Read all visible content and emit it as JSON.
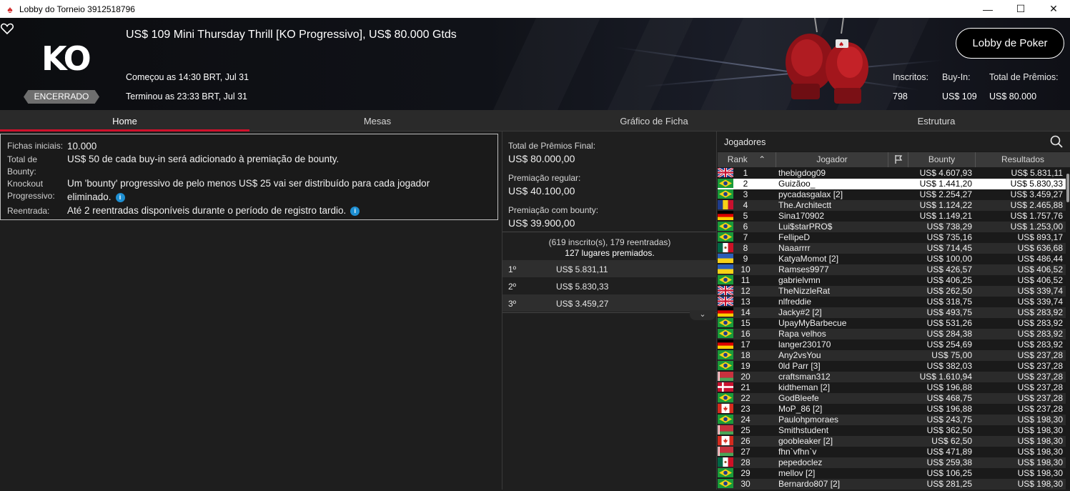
{
  "window": {
    "title": "Lobby do Torneio 3912518796",
    "minimize": "—",
    "maximize": "☐",
    "close": "✕"
  },
  "banner": {
    "ko_logo": "KO",
    "status": "ENCERRADO",
    "title": "US$ 109 Mini Thursday Thrill [KO Progressivo], US$ 80.000 Gtds",
    "started": "Começou as 14:30 BRT, Jul 31",
    "ended": "Terminou as 23:33 BRT, Jul 31",
    "lobby_button": "Lobby de Poker",
    "stats": {
      "registered_label": "Inscritos:",
      "registered_value": "798",
      "buyin_label": "Buy-In:",
      "buyin_value": "US$ 109",
      "prize_label": "Total de Prêmios:",
      "prize_value": "US$ 80.000"
    }
  },
  "tabs": [
    {
      "label": "Home",
      "active": true
    },
    {
      "label": "Mesas",
      "active": false
    },
    {
      "label": "Gráfico de Ficha",
      "active": false
    },
    {
      "label": "Estrutura",
      "active": false
    }
  ],
  "info": {
    "starting_chips_label": "Fichas iniciais:",
    "starting_chips_value": "10.000",
    "total_bounty_label": "Total de Bounty:",
    "total_bounty_value": "US$ 50 de cada buy-in será adicionado à premiação de bounty.",
    "knockout_label": "Knockout Progressivo:",
    "knockout_value": "Um 'bounty' progressivo de pelo menos US$ 25 vai ser distribuído para cada jogador eliminado.",
    "reentry_label": "Reentrada:",
    "reentry_value": "Até 2 reentradas disponíveis durante o período de registro tardio."
  },
  "prize": {
    "final_label": "Total de Prêmios Final:",
    "final_value": "US$ 80.000,00",
    "regular_label": "Premiação regular:",
    "regular_value": "US$ 40.100,00",
    "bounty_label": "Premiação com bounty:",
    "bounty_value": "US$ 39.900,00",
    "summary1": "(619 inscrito(s), 179 reentradas)",
    "summary2": "127 lugares premiados.",
    "places": [
      {
        "pos": "1º",
        "amount": "US$ 5.831,11"
      },
      {
        "pos": "2º",
        "amount": "US$ 5.830,33"
      },
      {
        "pos": "3º",
        "amount": "US$ 3.459,27"
      }
    ],
    "more": "⌄"
  },
  "players": {
    "title": "Jogadores",
    "columns": {
      "rank": "Rank",
      "rank_sort": "⌃",
      "player": "Jogador",
      "bounty": "Bounty",
      "results": "Resultados"
    },
    "rows": [
      {
        "rank": "1",
        "name": "thebigdog09",
        "flag": "uk",
        "bounty": "US$ 4.607,93",
        "result": "US$ 5.831,11"
      },
      {
        "rank": "2",
        "name": "Guizãoo_",
        "flag": "br",
        "bounty": "US$ 1.441,20",
        "result": "US$ 5.830,33"
      },
      {
        "rank": "3",
        "name": "pycadasgalax [2]",
        "flag": "br",
        "bounty": "US$ 2.254,27",
        "result": "US$ 3.459,27"
      },
      {
        "rank": "4",
        "name": "The.Architectt",
        "flag": "ro",
        "bounty": "US$ 1.124,22",
        "result": "US$ 2.465,88"
      },
      {
        "rank": "5",
        "name": "Sina170902",
        "flag": "de",
        "bounty": "US$ 1.149,21",
        "result": "US$ 1.757,76"
      },
      {
        "rank": "6",
        "name": "Lui$starPRO$",
        "flag": "br",
        "bounty": "US$ 738,29",
        "result": "US$ 1.253,00"
      },
      {
        "rank": "7",
        "name": "FellipeD",
        "flag": "br",
        "bounty": "US$ 735,16",
        "result": "US$ 893,17"
      },
      {
        "rank": "8",
        "name": "Naaarrrr",
        "flag": "mx",
        "bounty": "US$ 714,45",
        "result": "US$ 636,68"
      },
      {
        "rank": "9",
        "name": "KatyaMomot [2]",
        "flag": "ua",
        "bounty": "US$ 100,00",
        "result": "US$ 486,44"
      },
      {
        "rank": "10",
        "name": "Ramses9977",
        "flag": "ua",
        "bounty": "US$ 426,57",
        "result": "US$ 406,52"
      },
      {
        "rank": "11",
        "name": "gabrielvmn",
        "flag": "br",
        "bounty": "US$ 406,25",
        "result": "US$ 406,52"
      },
      {
        "rank": "12",
        "name": "TheNizzleRat",
        "flag": "uk",
        "bounty": "US$ 262,50",
        "result": "US$ 339,74"
      },
      {
        "rank": "13",
        "name": "nlfreddie",
        "flag": "uk",
        "bounty": "US$ 318,75",
        "result": "US$ 339,74"
      },
      {
        "rank": "14",
        "name": "Jacky#2 [2]",
        "flag": "de",
        "bounty": "US$ 493,75",
        "result": "US$ 283,92"
      },
      {
        "rank": "15",
        "name": "UpayMyBarbecue",
        "flag": "br",
        "bounty": "US$ 531,26",
        "result": "US$ 283,92"
      },
      {
        "rank": "16",
        "name": "Rapa velhos",
        "flag": "br",
        "bounty": "US$ 284,38",
        "result": "US$ 283,92"
      },
      {
        "rank": "17",
        "name": "langer230170",
        "flag": "de",
        "bounty": "US$ 254,69",
        "result": "US$ 283,92"
      },
      {
        "rank": "18",
        "name": "Any2vsYou",
        "flag": "br",
        "bounty": "US$ 75,00",
        "result": "US$ 237,28"
      },
      {
        "rank": "19",
        "name": "0ld Parr [3]",
        "flag": "br",
        "bounty": "US$ 382,03",
        "result": "US$ 237,28"
      },
      {
        "rank": "20",
        "name": "craftsman312",
        "flag": "by",
        "bounty": "US$ 1.610,94",
        "result": "US$ 237,28"
      },
      {
        "rank": "21",
        "name": "kidtheman [2]",
        "flag": "dk",
        "bounty": "US$ 196,88",
        "result": "US$ 237,28"
      },
      {
        "rank": "22",
        "name": "GodBleefe",
        "flag": "br",
        "bounty": "US$ 468,75",
        "result": "US$ 237,28"
      },
      {
        "rank": "23",
        "name": "MoP_86 [2]",
        "flag": "ca",
        "bounty": "US$ 196,88",
        "result": "US$ 237,28"
      },
      {
        "rank": "24",
        "name": "Paulohpmoraes",
        "flag": "br",
        "bounty": "US$ 243,75",
        "result": "US$ 198,30"
      },
      {
        "rank": "25",
        "name": "Smithstudent",
        "flag": "by",
        "bounty": "US$ 362,50",
        "result": "US$ 198,30"
      },
      {
        "rank": "26",
        "name": "goobleaker [2]",
        "flag": "ca",
        "bounty": "US$ 62,50",
        "result": "US$ 198,30"
      },
      {
        "rank": "27",
        "name": "fhn`vfhn`v",
        "flag": "by",
        "bounty": "US$ 471,89",
        "result": "US$ 198,30"
      },
      {
        "rank": "28",
        "name": "pepedoclez",
        "flag": "mx",
        "bounty": "US$ 259,38",
        "result": "US$ 198,30"
      },
      {
        "rank": "29",
        "name": "mellov [2]",
        "flag": "br",
        "bounty": "US$ 106,25",
        "result": "US$ 198,30"
      },
      {
        "rank": "30",
        "name": "Bernardo807 [2]",
        "flag": "br",
        "bounty": "US$ 281,25",
        "result": "US$ 198,30"
      }
    ],
    "selected_rank": "2"
  },
  "colors": {
    "accent": "#d0112b",
    "info_icon": "#1e8fd2",
    "background": "#1e1e1e"
  }
}
